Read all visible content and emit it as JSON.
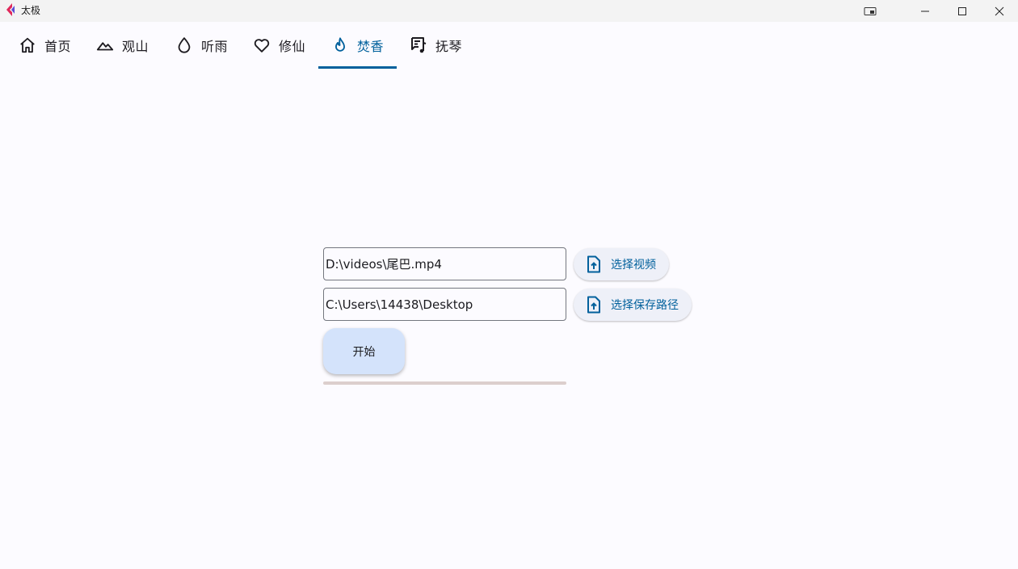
{
  "window": {
    "title": "太极",
    "accent_color": "#00609c"
  },
  "tabs": [
    {
      "label": "首页",
      "icon": "home-icon",
      "selected": false
    },
    {
      "label": "观山",
      "icon": "mountain-icon",
      "selected": false
    },
    {
      "label": "听雨",
      "icon": "water-drop-icon",
      "selected": false
    },
    {
      "label": "修仙",
      "icon": "heart-icon",
      "selected": false
    },
    {
      "label": "焚香",
      "icon": "flame-icon",
      "selected": true
    },
    {
      "label": "抚琴",
      "icon": "music-note-list-icon",
      "selected": false
    }
  ],
  "form": {
    "video_path": "D:\\videos\\尾巴.mp4",
    "save_path": "C:\\Users\\14438\\Desktop",
    "choose_video_label": "选择视频",
    "choose_save_label": "选择保存路径",
    "start_label": "开始",
    "button_icon": "file-upload-icon"
  },
  "progress": {
    "value": 0
  }
}
